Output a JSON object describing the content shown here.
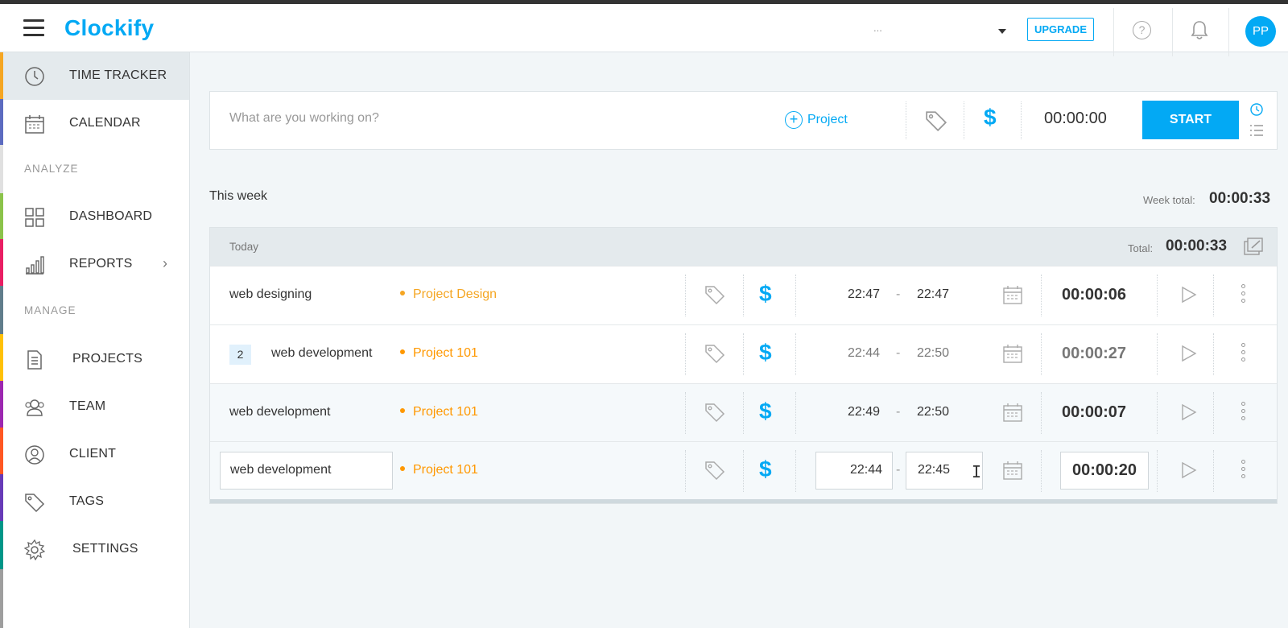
{
  "header": {
    "logo": "Clockify",
    "workspace_label": "...",
    "upgrade_label": "UPGRADE",
    "help_label": "?",
    "avatar_initials": "PP"
  },
  "sidebar": {
    "items": [
      {
        "label": "TIME TRACKER",
        "icon": "clock-icon",
        "active": true
      },
      {
        "label": "CALENDAR",
        "icon": "calendar-icon"
      },
      {
        "label": "DASHBOARD",
        "icon": "dashboard-grid-icon"
      },
      {
        "label": "REPORTS",
        "icon": "bar-chart-icon"
      },
      {
        "label": "PROJECTS",
        "icon": "document-icon"
      },
      {
        "label": "TEAM",
        "icon": "team-icon"
      },
      {
        "label": "CLIENT",
        "icon": "client-icon"
      },
      {
        "label": "TAGS",
        "icon": "tag-icon"
      },
      {
        "label": "SETTINGS",
        "icon": "gear-icon"
      }
    ],
    "sections": {
      "analyze": "ANALYZE",
      "manage": "MANAGE"
    },
    "accent_colors": [
      "#f5a623",
      "#5c6bc0",
      "#8bc34a",
      "#e91e63",
      "#607d8b",
      "#ffc107",
      "#9c27b0",
      "#ff5722",
      "#673ab7",
      "#009688"
    ]
  },
  "tracker": {
    "placeholder": "What are you working on?",
    "project_label": "Project",
    "timer": "00:00:00",
    "start_label": "START"
  },
  "week": {
    "label": "This week",
    "total_label": "Week total:",
    "total": "00:00:33"
  },
  "group": {
    "title": "Today",
    "total_label": "Total:",
    "total": "00:00:33",
    "entries": [
      {
        "description": "web designing",
        "project": "Project Design",
        "project_color": "#f5a623",
        "start": "22:47",
        "end": "22:47",
        "duration": "00:00:06"
      },
      {
        "count": "2",
        "description": "web development",
        "project": "Project 101",
        "project_color": "#ff9800",
        "start": "22:44",
        "end": "22:50",
        "duration": "00:00:27"
      },
      {
        "description": "web development",
        "project": "Project 101",
        "project_color": "#ff9800",
        "start": "22:49",
        "end": "22:50",
        "duration": "00:00:07"
      },
      {
        "description": "web development",
        "project": "Project 101",
        "project_color": "#ff9800",
        "start": "22:44",
        "end": "22:45",
        "duration": "00:00:20"
      }
    ],
    "separator": "-"
  },
  "colors": {
    "accent": "#03a9f4",
    "project_orange": "#ff9800",
    "project_yellow": "#f5a623"
  }
}
